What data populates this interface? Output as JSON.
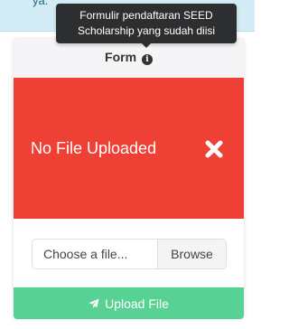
{
  "alert": {
    "text": "ya."
  },
  "tooltip": {
    "text": "Formulir pendaftaran SEED Scholarship yang sudah diisi"
  },
  "card": {
    "title": "Form",
    "status_text": "No File Uploaded",
    "status_color": "#ee4035",
    "file_input_placeholder": "Choose a file...",
    "browse_label": "Browse",
    "upload_label": "Upload File",
    "upload_color": "#58d195"
  },
  "icons": {
    "info": "info-circle-icon",
    "close": "close-icon",
    "upload": "paper-plane-icon"
  }
}
